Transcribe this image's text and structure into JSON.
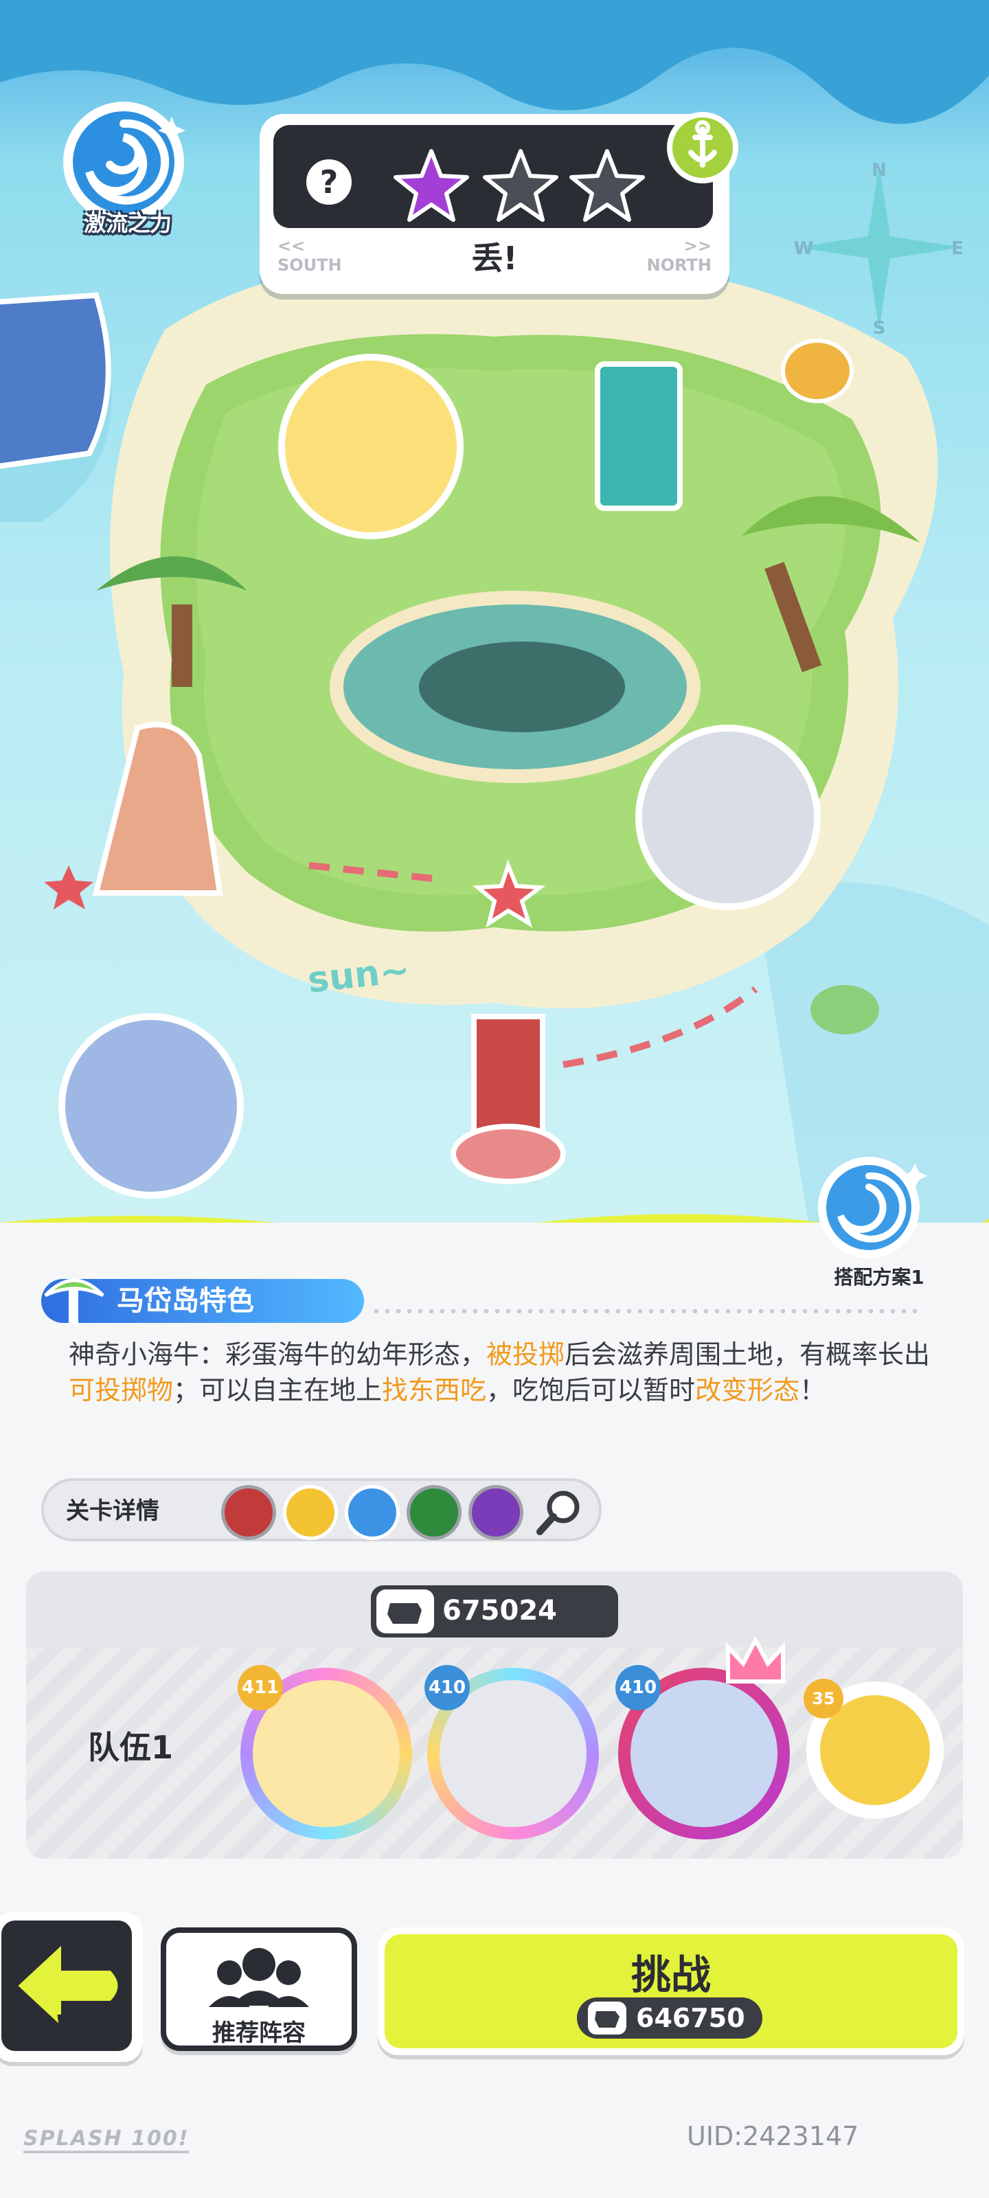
{
  "map": {
    "force_label": "激流之力",
    "title": "丢!",
    "nav_left": "<<\nSOUTH",
    "nav_right": ">>\nNORTH",
    "stars": [
      "filled",
      "empty",
      "empty"
    ],
    "compass_letters": [
      "N",
      "W",
      "E",
      "S"
    ],
    "map_caption": "sun~",
    "combo_label": "搭配方案1"
  },
  "feature": {
    "title": "马岱岛特色",
    "text_parts": [
      {
        "t": "神奇小海牛：彩蛋海牛的幼年形态，",
        "hl": false
      },
      {
        "t": "被投掷",
        "hl": true
      },
      {
        "t": "后会滋养周围土地，有概率长出",
        "hl": false
      },
      {
        "t": "可投掷物",
        "hl": true
      },
      {
        "t": "；可以自主在地上",
        "hl": false
      },
      {
        "t": "找东西吃",
        "hl": true
      },
      {
        "t": "，吃饱后可以暂时",
        "hl": false
      },
      {
        "t": "改变形态",
        "hl": true
      },
      {
        "t": "！",
        "hl": false
      }
    ]
  },
  "details": {
    "label": "关卡详情",
    "tokens": [
      "red-splat-icon",
      "yellow-splat-icon",
      "blue-splat-icon",
      "green-splat-icon",
      "purple-splat-icon"
    ]
  },
  "team": {
    "power": "675024",
    "name": "队伍1",
    "members": [
      {
        "level": "411",
        "badge_color": "#f3b634"
      },
      {
        "level": "410",
        "badge_color": "#3b8ed8"
      },
      {
        "level": "410",
        "badge_color": "#3b8ed8"
      },
      {
        "level": "35",
        "badge_color": "#f3b634"
      }
    ]
  },
  "buttons": {
    "back": "BACK",
    "recommend": "推荐阵容",
    "challenge": "挑战",
    "challenge_power": "646750"
  },
  "footer": {
    "logo": "SPLASH 100!",
    "uid": "UID:2423147"
  },
  "colors": {
    "accent_yellow": "#e3f23a",
    "highlight_orange": "#f19a1c",
    "dark": "#2a2d33",
    "blue": "#2f6ee0"
  }
}
